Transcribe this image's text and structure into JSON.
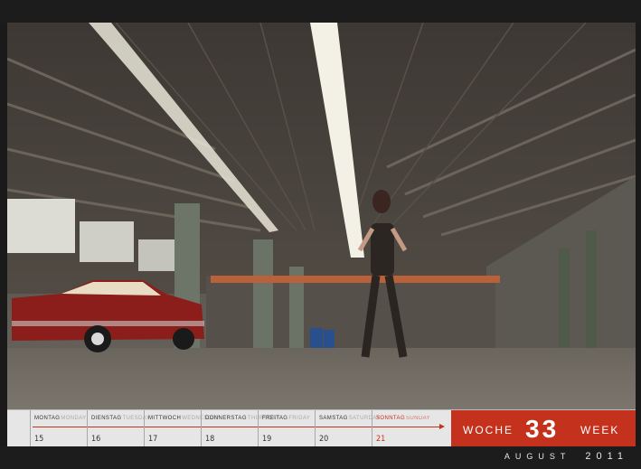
{
  "calendar": {
    "days": [
      {
        "de": "MONTAG",
        "en": "MONDAY",
        "date": "15"
      },
      {
        "de": "DIENSTAG",
        "en": "TUESDAY",
        "date": "16"
      },
      {
        "de": "MITTWOCH",
        "en": "WEDNESDAY",
        "date": "17"
      },
      {
        "de": "DONNERSTAG",
        "en": "THURSDAY",
        "date": "18"
      },
      {
        "de": "FREITAG",
        "en": "FRIDAY",
        "date": "19"
      },
      {
        "de": "SAMSTAG",
        "en": "SATURDAY",
        "date": "20"
      },
      {
        "de": "SONNTAG",
        "en": "SUNDAY",
        "date": "21"
      }
    ],
    "week": {
      "label_de": "WOCHE",
      "number": "33",
      "label_en": "WEEK"
    },
    "month": "AUGUST",
    "year": "2011"
  },
  "colors": {
    "accent": "#c4311d",
    "strip_bg": "#e6e6e6",
    "frame": "#1c1c1c"
  },
  "photo": {
    "subject": "warehouse-hall-with-vintage-red-car-and-model"
  }
}
